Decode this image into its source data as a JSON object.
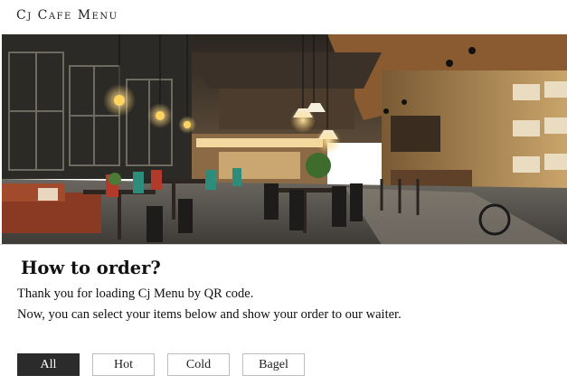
{
  "header": {
    "brand": "Cj Cafe Menu"
  },
  "hero": {
    "image": "cafe-interior-photo"
  },
  "intro": {
    "title": "How to order?",
    "line1": "Thank you for loading Cj Menu by QR code.",
    "line2": "Now, you can select your items below and show your order to our waiter."
  },
  "filters": [
    {
      "label": "All",
      "active": true
    },
    {
      "label": "Hot",
      "active": false
    },
    {
      "label": "Cold",
      "active": false
    },
    {
      "label": "Bagel",
      "active": false
    }
  ]
}
